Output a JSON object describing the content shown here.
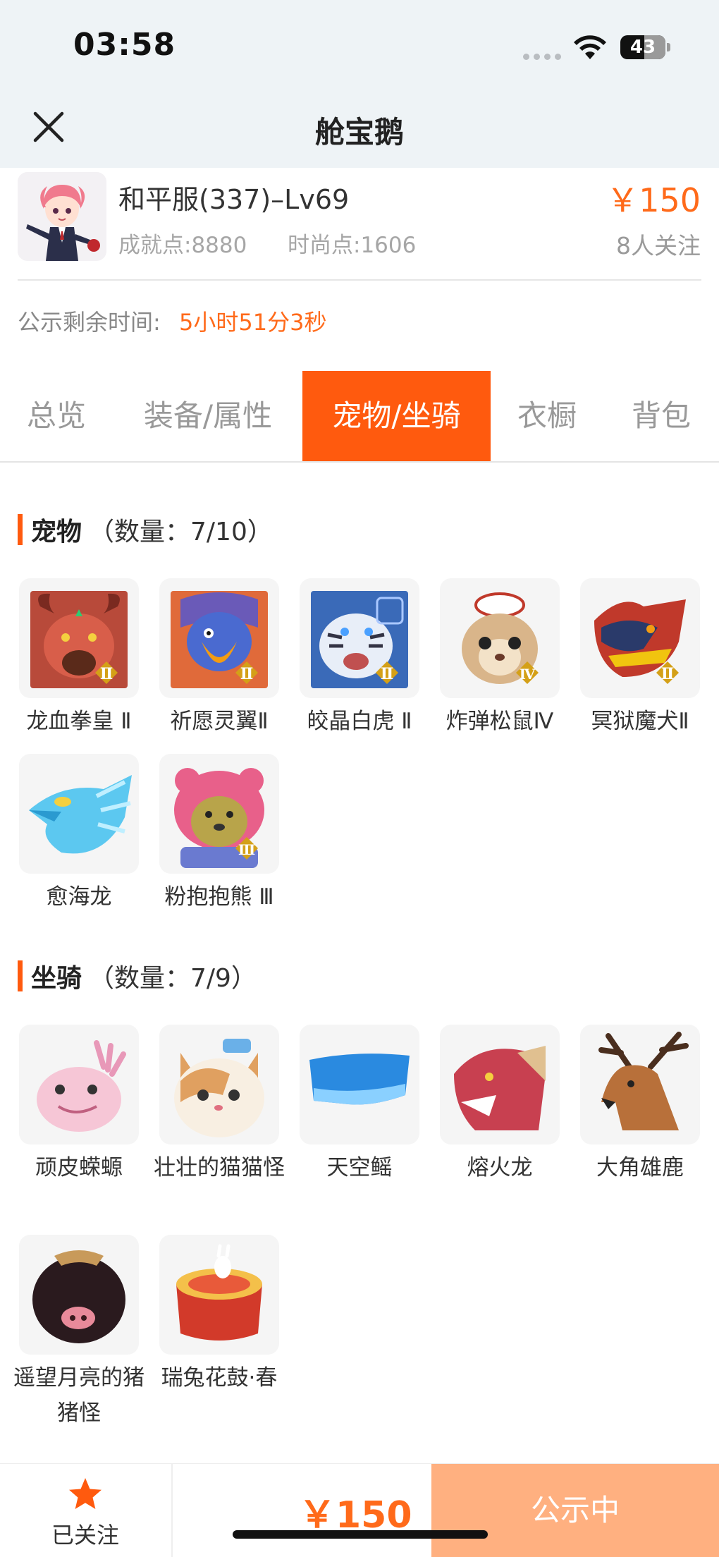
{
  "status_bar": {
    "time": "03:58",
    "battery": "43"
  },
  "nav": {
    "title": "舱宝鹅"
  },
  "listing": {
    "title": "和平服(337)–Lv69",
    "achievement": "成就点:8880",
    "fashion": "时尚点:1606",
    "price": "￥150",
    "followers": "8人关注",
    "countdown_label": "公示剩余时间:",
    "countdown_value": "5小时51分3秒"
  },
  "tabs": [
    {
      "label": "总览",
      "active": false
    },
    {
      "label": "装备/属性",
      "active": false
    },
    {
      "label": "宠物/坐骑",
      "active": true
    },
    {
      "label": "衣橱",
      "active": false
    },
    {
      "label": "背包",
      "active": false
    }
  ],
  "pets": {
    "title": "宠物",
    "count": "（数量：7/10）",
    "items": [
      {
        "name": "龙血拳皇 Ⅱ",
        "badge": "Ⅱ",
        "icon": "red-dragon-icon"
      },
      {
        "name": "祈愿灵翼Ⅱ",
        "badge": "Ⅱ",
        "icon": "griffin-icon"
      },
      {
        "name": "皎晶白虎 Ⅱ",
        "badge": "Ⅱ",
        "icon": "white-tiger-icon"
      },
      {
        "name": "炸弹松鼠Ⅳ",
        "badge": "Ⅳ",
        "icon": "squirrel-icon"
      },
      {
        "name": "冥狱魔犬Ⅱ",
        "badge": "Ⅱ",
        "icon": "hellhound-icon"
      },
      {
        "name": "愈海龙",
        "badge": "",
        "icon": "sea-dragon-icon"
      },
      {
        "name": "粉抱抱熊 Ⅲ",
        "badge": "Ⅲ",
        "icon": "pink-bear-icon"
      }
    ]
  },
  "mounts": {
    "title": "坐骑",
    "count": "（数量：7/9）",
    "items": [
      {
        "name": "顽皮蝾螈",
        "icon": "axolotl-icon"
      },
      {
        "name": "壮壮的猫猫怪",
        "icon": "cat-icon"
      },
      {
        "name": "天空鳐",
        "icon": "sky-ray-icon"
      },
      {
        "name": "熔火龙",
        "icon": "lava-dragon-icon"
      },
      {
        "name": "大角雄鹿",
        "icon": "stag-icon"
      },
      {
        "name": "遥望月亮的猪猪怪",
        "icon": "pig-icon"
      },
      {
        "name": "瑞兔花鼓·春",
        "icon": "drum-icon"
      }
    ]
  },
  "bottom": {
    "follow_label": "已关注",
    "price": "￥150",
    "status": "公示中"
  },
  "colors": {
    "accent": "#ff5a0e",
    "price": "#ff6a1a",
    "status_button": "#ffb080"
  }
}
